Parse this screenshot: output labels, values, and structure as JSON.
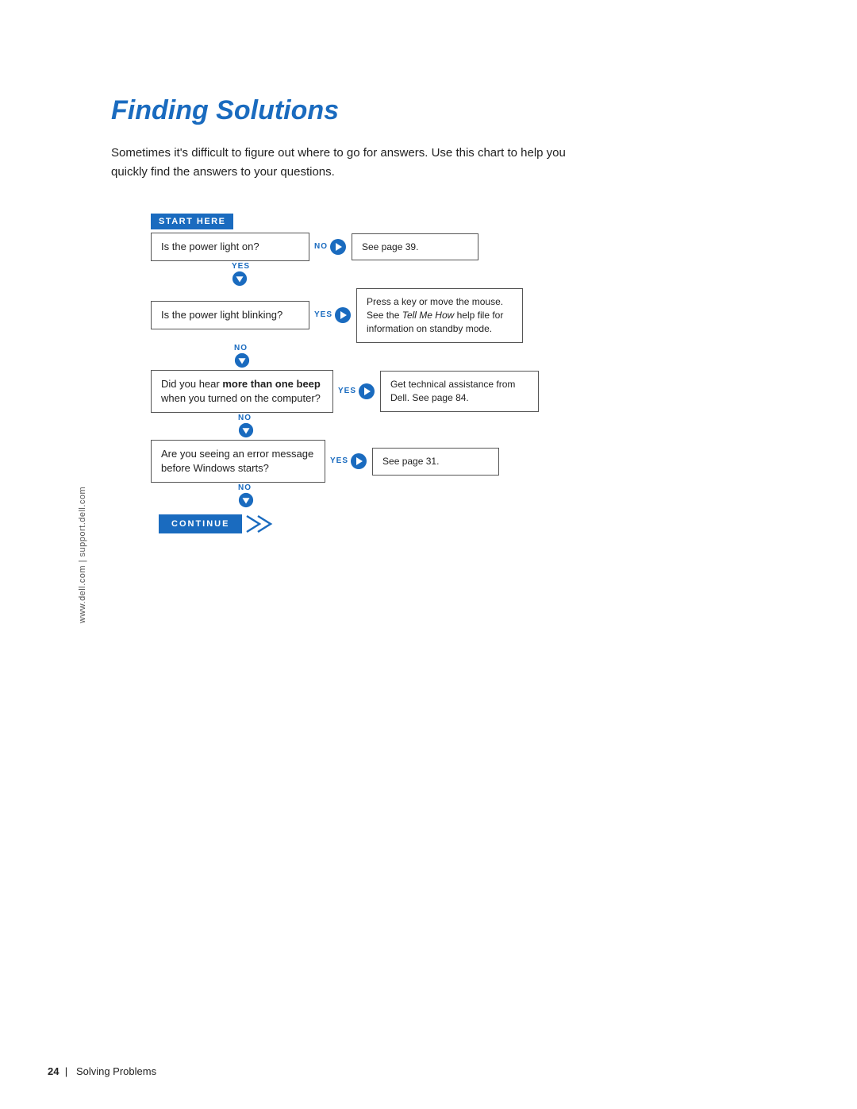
{
  "sidebar": {
    "text": "www.dell.com | support.dell.com"
  },
  "page": {
    "title": "Finding Solutions",
    "intro": "Sometimes it's difficult to figure out where to go for answers. Use this chart to help you quickly find the answers to your questions."
  },
  "flowchart": {
    "start_here": "START HERE",
    "steps": [
      {
        "id": "step1",
        "question": "Is the power light on?",
        "no_answer": "See page 39.",
        "yes_label": "YES",
        "no_label": "NO"
      },
      {
        "id": "step2",
        "question": "Is the power light blinking?",
        "yes_answer": "Press a key or move the mouse. See the Tell Me How help file for information on standby mode.",
        "yes_answer_italic": "Tell Me How",
        "yes_label": "YES",
        "no_label": "NO"
      },
      {
        "id": "step3",
        "question_part1": "Did you hear ",
        "question_bold": "more than one beep",
        "question_part2": " when you turned on the computer?",
        "yes_answer": "Get technical assistance from Dell. See page 84.",
        "yes_label": "YES",
        "no_label": "NO"
      },
      {
        "id": "step4",
        "question": "Are you seeing an error message before Windows starts?",
        "yes_answer": "See page 31.",
        "yes_label": "YES",
        "no_label": "NO"
      }
    ],
    "continue_label": "CONTINUE"
  },
  "footer": {
    "page_number": "24",
    "section": "Solving Problems"
  },
  "colors": {
    "blue": "#1a6bbf",
    "dark_text": "#222",
    "border": "#555"
  }
}
